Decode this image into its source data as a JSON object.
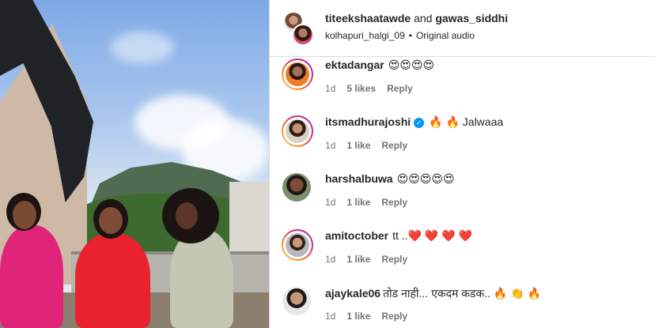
{
  "header": {
    "user1": "titeekshaatawde",
    "joiner": "and",
    "user2": "gawas_siddhi",
    "audio_user": "kolhapuri_halgi_09",
    "audio_sep": "•",
    "audio_label": "Original audio"
  },
  "comments": [
    {
      "username": "ektadangar",
      "text": "😍😍😍😍",
      "time": "1d",
      "likes": "5 likes",
      "reply": "Reply"
    },
    {
      "username": "itsmadhurajoshi",
      "verified_icon": "✓",
      "text": "🔥 🔥 Jalwaaa",
      "time": "1d",
      "likes": "1 like",
      "reply": "Reply"
    },
    {
      "username": "harshalbuwa",
      "text": "😍😍😍😍😍",
      "time": "1d",
      "likes": "1 like",
      "reply": "Reply"
    },
    {
      "username": "amitoctober",
      "text": "tt ..❤️ ❤️ ❤️ ❤️",
      "time": "1d",
      "likes": "1 like",
      "reply": "Reply"
    },
    {
      "username": "ajaykale06",
      "text": "तोड नाही... एकदम कडक.. 🔥 👏 🔥",
      "time": "1d",
      "likes": "1 like",
      "reply": "Reply"
    }
  ],
  "colors": {
    "verified": "#0095f6",
    "text": "#262626",
    "muted": "#737373"
  },
  "icons": {
    "verified": "verified-badge-icon"
  }
}
